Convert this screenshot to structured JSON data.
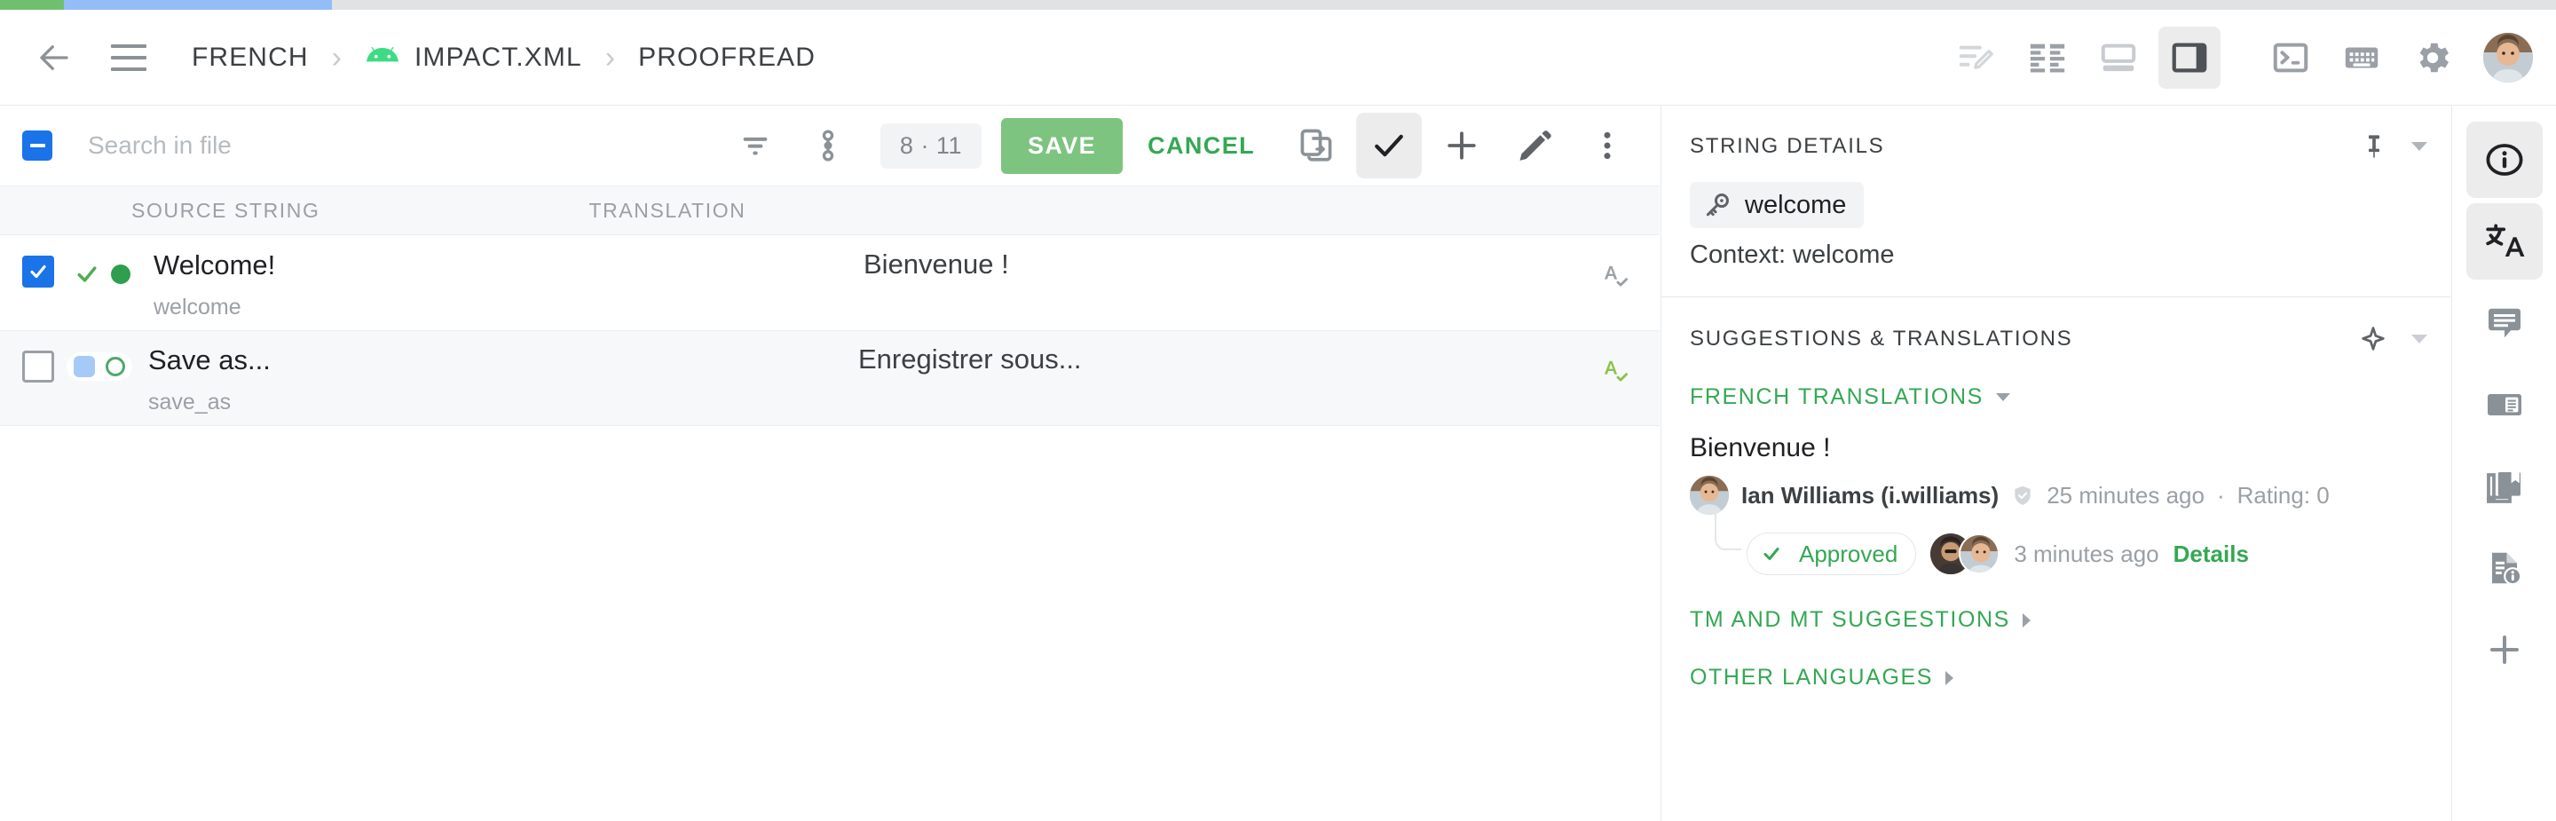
{
  "header": {
    "back_icon": "arrow-back-icon",
    "menu_icon": "hamburger-menu-icon",
    "breadcrumb": [
      {
        "label": "FRENCH",
        "icon": null
      },
      {
        "label": "IMPACT.XML",
        "icon": "android-icon"
      },
      {
        "label": "PROOFREAD",
        "icon": null
      }
    ],
    "tools": [
      {
        "name": "edit-lines-icon",
        "active": false
      },
      {
        "name": "split-columns-icon",
        "active": false
      },
      {
        "name": "horizontal-layout-icon",
        "active": false
      },
      {
        "name": "side-panel-layout-icon",
        "active": true
      },
      {
        "name": "terminal-icon",
        "active": false
      },
      {
        "name": "keyboard-icon",
        "active": false
      },
      {
        "name": "settings-gear-icon",
        "active": false
      },
      {
        "name": "user-avatar",
        "active": false
      }
    ]
  },
  "toolbar": {
    "select_all_state": "indeterminate",
    "search": {
      "value": "",
      "placeholder": "Search in file"
    },
    "filter_icon": "filter-icon",
    "sort_icon": "sort-range-icon",
    "counter": "8 · 11",
    "save_label": "SAVE",
    "cancel_label": "CANCEL",
    "actions": [
      {
        "name": "copy-to-device-icon",
        "active": false
      },
      {
        "name": "approve-check-icon",
        "active": true
      },
      {
        "name": "add-plus-icon",
        "active": false
      },
      {
        "name": "edit-pencil-icon",
        "active": false
      },
      {
        "name": "more-vertical-icon",
        "active": false
      }
    ]
  },
  "table": {
    "columns": [
      "SOURCE STRING",
      "TRANSLATION"
    ],
    "rows": [
      {
        "checked": true,
        "status_check": true,
        "status_dot": "filled",
        "source": "Welcome!",
        "key": "welcome",
        "translation": "Bienvenue !",
        "spellcheck_icon_color": "#9aa0a6"
      },
      {
        "checked": false,
        "status_check": false,
        "status_dot": "ring",
        "source": "Save as...",
        "key": "save_as",
        "translation": "Enregistrer sous...",
        "spellcheck_icon_color": "#8bc34a"
      }
    ]
  },
  "panel": {
    "string_details": {
      "title": "STRING DETAILS",
      "pin_icon": "pin-icon",
      "collapse_icon": "chevron-down-icon",
      "key_icon": "key-icon",
      "key": "welcome",
      "context": "Context: welcome"
    },
    "suggestions": {
      "title": "SUGGESTIONS & TRANSLATIONS",
      "spark_icon": "auto-suggest-icon",
      "collapse_icon": "chevron-down-icon",
      "group_label": "FRENCH TRANSLATIONS",
      "entry": {
        "text": "Bienvenue !",
        "author": "Ian Williams (i.williams)",
        "verified_icon": "verified-shield-icon",
        "time": "25 minutes ago",
        "separator": "·",
        "rating": "Rating: 0",
        "approved_label": "Approved",
        "approved_time": "3 minutes ago",
        "details_label": "Details"
      },
      "collapsed_sections": [
        {
          "label": "TM AND MT SUGGESTIONS"
        },
        {
          "label": "OTHER LANGUAGES"
        }
      ]
    }
  },
  "rail": [
    {
      "name": "info-circle-icon",
      "active": true
    },
    {
      "name": "translate-icon",
      "active": true
    },
    {
      "name": "comment-icon",
      "active": false
    },
    {
      "name": "article-panel-icon",
      "active": false
    },
    {
      "name": "glossary-book-icon",
      "active": false
    },
    {
      "name": "file-info-icon",
      "active": false
    },
    {
      "name": "add-plus-icon",
      "active": false
    }
  ],
  "colors": {
    "accent_green": "#34a853",
    "save_green": "#7cc47f",
    "checkbox_blue": "#1a73e8",
    "progress_green": "#6fc06e",
    "progress_blue": "#93bdf7"
  }
}
